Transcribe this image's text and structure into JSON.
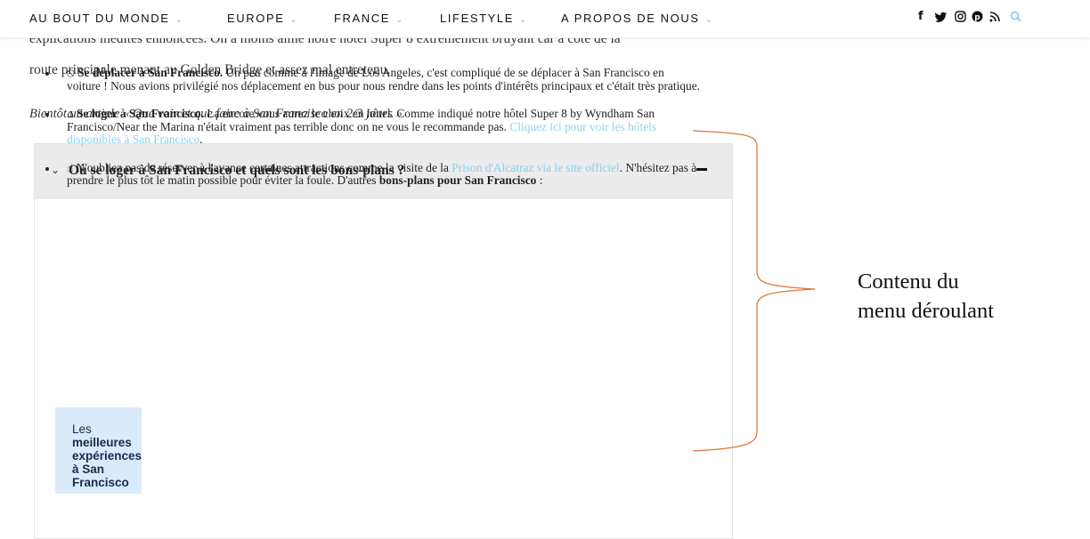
{
  "nav": {
    "items": [
      {
        "label": "AU BOUT DU MONDE"
      },
      {
        "label": "EUROPE"
      },
      {
        "label": "FRANCE"
      },
      {
        "label": "LIFESTYLE"
      },
      {
        "label": "A PROPOS DE NOUS"
      }
    ],
    "chevron": "⌄",
    "social_icons": [
      "facebook-icon",
      "twitter-icon",
      "instagram-icon",
      "pinterest-icon",
      "rss-icon",
      "search-icon"
    ],
    "social_glyphs": {
      "facebook": "f",
      "twitter": "🐦",
      "instagram": "◎",
      "pinterest": "℗",
      "rss": "⋑",
      "search": "🔍"
    }
  },
  "article": {
    "clipped_line": "explications inédites ennoncées. On a moins aimé notre hôtel Super 8 extrêmement bruyant car à côté de la",
    "para_line": "route principale menant au Golden Bridge et assez mal entretenu.",
    "soon": "Bientôt un article « Que voir et que faire à San Francisco en 2/3 jours »"
  },
  "accordion": {
    "title": "Où se loger à San Francisco et quels sont les bons-plans ?",
    "expanded": true,
    "bullets": [
      {
        "icon": "⃠",
        "bold": "Se déplacer à San Francisco.",
        "text": " Un peu comme à l'image de Los Angeles, c'est compliqué de se déplacer à San Francisco en voiture ! Nous avions privilégié nos déplacement en bus pour nous rendre dans les points d'intérêts principaux et c'était très pratique."
      },
      {
        "icon": "🏠",
        "bold": "Se loger à San Francisco.",
        "text": " La encore vous aurez le choix en hôtel. Comme indiqué notre hôtel Super 8 by Wyndham San Francisco/Near the Marina n'était vraiment pas terrible donc on ne vous le recommande pas.",
        "link": "Cliquez ici pour voir les hôtels disponibles à San Francisco",
        "after": "."
      },
      {
        "icon": "👍",
        "pre": "N'oubliez pas de réserver à l'avance certaines attractions comme la visite de la ",
        "link": "Prison d'Alcatraz via le site officiel",
        "mid": ". N'hésitez pas à prendre le plus tôt le matin possible pour éviter la foule. D'autres ",
        "bold": "bons-plans pour San Francisco",
        "after": " :"
      }
    ]
  },
  "card": {
    "line1": "Les",
    "line2": "meilleures",
    "line3": "expériences",
    "line4": "à San",
    "line5": "Francisco"
  },
  "annotation": {
    "line1": "Contenu du",
    "line2": "menu déroulant",
    "color": "#e0763a"
  }
}
